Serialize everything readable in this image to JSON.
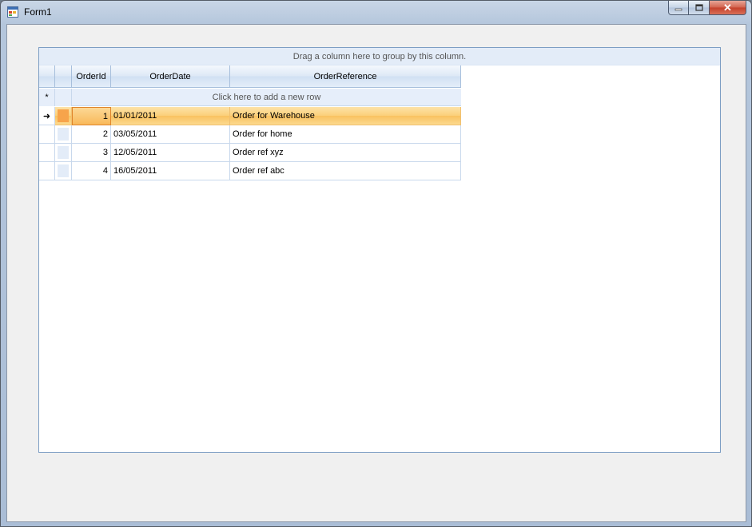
{
  "window": {
    "title": "Form1",
    "icon": "winforms-app-icon",
    "controls": {
      "minimize_icon": "minimize-icon",
      "maximize_icon": "maximize-icon",
      "close_icon": "close-icon"
    }
  },
  "grid": {
    "group_panel_text": "Drag a column here to group by this column.",
    "columns": [
      "OrderId",
      "OrderDate",
      "OrderReference"
    ],
    "new_row_text": "Click here to add a new row",
    "new_row_marker": "*",
    "current_row_marker": "➜",
    "current_row_index": 0,
    "rows": [
      {
        "id": "1",
        "date": "01/01/2011",
        "ref": "Order for Warehouse"
      },
      {
        "id": "2",
        "date": "03/05/2011",
        "ref": "Order for home"
      },
      {
        "id": "3",
        "date": "12/05/2011",
        "ref": "Order ref xyz"
      },
      {
        "id": "4",
        "date": "16/05/2011",
        "ref": "Order ref abc"
      }
    ]
  },
  "colors": {
    "selection_orange": "#f9c260",
    "header_blue": "#d0e0f3",
    "grid_border": "#7d9ec4"
  }
}
